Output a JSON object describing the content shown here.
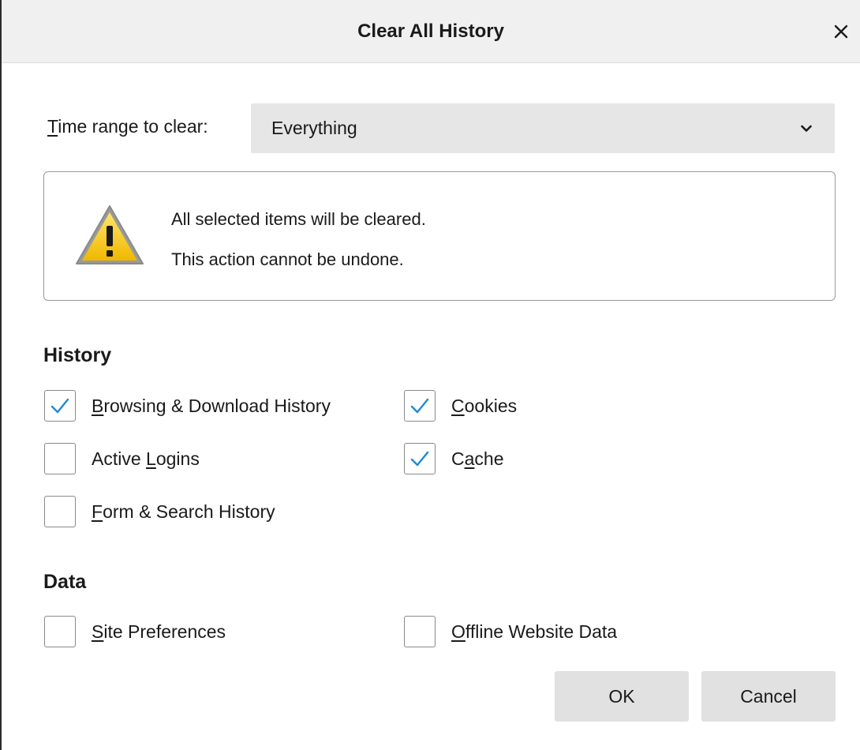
{
  "dialog": {
    "title": "Clear All History"
  },
  "time_range": {
    "label_first": "T",
    "label_rest": "ime range to clear:",
    "selected": "Everything"
  },
  "warning": {
    "line1": "All selected items will be cleared.",
    "line2": "This action cannot be undone."
  },
  "history": {
    "heading": "History",
    "items": [
      {
        "pre": "",
        "key": "B",
        "post": "rowsing & Download History",
        "checked": true
      },
      {
        "pre": "",
        "key": "C",
        "post": "ookies",
        "checked": true
      },
      {
        "pre": "Active ",
        "key": "L",
        "post": "ogins",
        "checked": false
      },
      {
        "pre": "C",
        "key": "a",
        "post": "che",
        "checked": true
      },
      {
        "pre": "",
        "key": "F",
        "post": "orm & Search History",
        "checked": false
      }
    ]
  },
  "data_section": {
    "heading": "Data",
    "items": [
      {
        "pre": "",
        "key": "S",
        "post": "ite Preferences",
        "checked": false
      },
      {
        "pre": "",
        "key": "O",
        "post": "ffline Website Data",
        "checked": false
      }
    ]
  },
  "buttons": {
    "ok": "OK",
    "cancel": "Cancel"
  },
  "colors": {
    "checkmark": "#1e8ad6",
    "warning_yellow": "#f5c400",
    "button_bg": "#e1e1e1",
    "select_bg": "#e6e6e6"
  },
  "icons": {
    "close": "close-icon",
    "chevron": "chevron-down-icon",
    "warning": "warning-icon",
    "checkmark": "checkmark-icon"
  }
}
